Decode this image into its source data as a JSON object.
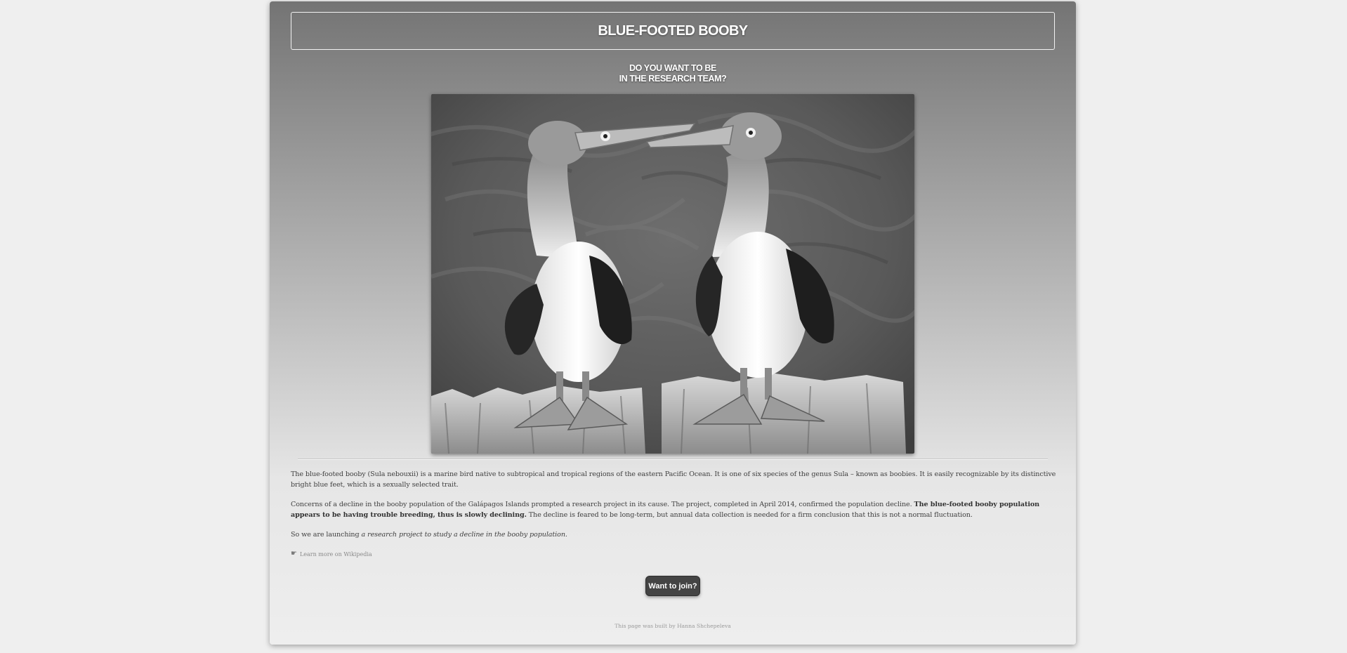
{
  "header": {
    "title": "BLUE-FOOTED BOOBY",
    "subtitle_line1": "DO YOU WANT TO BE",
    "subtitle_line2": "IN THE RESEARCH TEAM?"
  },
  "content": {
    "p1": "The blue-footed booby (Sula nebouxii) is a marine bird native to subtropical and tropical regions of the eastern Pacific Ocean. It is one of six species of the genus Sula – known as boobies. It is easily recognizable by its distinctive bright blue feet, which is a sexually selected trait.",
    "p2_start": "Concerns of a decline in the booby population of the Galápagos Islands prompted a research project in its cause. The project, completed in April 2014, confirmed the population decline. ",
    "p2_bold": "The blue-footed booby population appears to be having trouble breeding, thus is slowly declining.",
    "p2_end": " The decline is feared to be long-term, but annual data collection is needed for a firm conclusion that this is not a normal fluctuation.",
    "p3_start": "So we are launching ",
    "p3_italic": "a research project to study a decline in the booby population",
    "p3_end": ".",
    "wiki_link": "Learn more on Wikipedia",
    "wiki_icon": "pointing-hand-icon"
  },
  "actions": {
    "join_label": "Want to join?"
  },
  "footer": {
    "credit": "This page was built by Hanna Shchepeleva"
  },
  "colors": {
    "button_bg": "#444444",
    "title_border": "#f2f2f2"
  }
}
